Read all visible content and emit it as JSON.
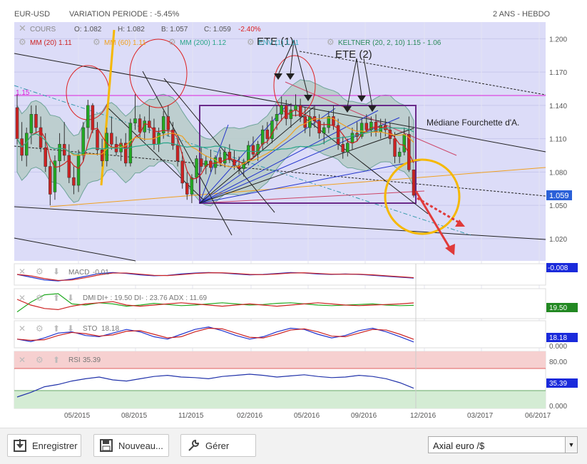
{
  "header": {
    "pair": "EUR-USD",
    "variation": "VARIATION PERIODE : -5.45%",
    "range": "2 ANS - HEBDO"
  },
  "legend": {
    "cours": "COURS",
    "o": "O: 1.082",
    "h": "H: 1.082",
    "b": "B: 1.057",
    "c": "C: 1.059",
    "c_change": "-2.40%",
    "mm20": "MM (20)  1.11",
    "mm60": "MM (60)  1.11",
    "mm200": "MM (200)  1.12",
    "env": "ENV (1)  1.11",
    "keltner": "KELTNER (20, 2, 10)  1.15 - 1.06"
  },
  "annotations": {
    "ete1": "ETE (1)",
    "ete2": "ETE (2)",
    "mediane": "Médiane Fourchette d'A.",
    "level_115": "1.15"
  },
  "colors": {
    "up": "#22aa22",
    "down": "#cc2222",
    "mm20": "#cc2222",
    "mm60": "#f0a020",
    "mm200": "#2aa58a",
    "keltner_fill": "#b7cbc8",
    "panel_bg": "#dcdcf8",
    "rsi_high": "#f6d0d0",
    "rsi_low": "#d4ecd4",
    "orange_mark": "#f5b800",
    "price_badge": "#2a60d8"
  },
  "indicators": {
    "macd": {
      "label": "MACD",
      "value": "-0.01",
      "badge": "-0.008"
    },
    "dmi": {
      "label": "DMI",
      "text": "DI+ : 19.50 DI- : 23.76 ADX : 11.69",
      "badge": "19.50"
    },
    "sto": {
      "label": "STO",
      "value": "18.18",
      "badge": "18.18",
      "axis": "0.000"
    },
    "rsi": {
      "label": "RSI",
      "value": "35.39",
      "badge": "35.39",
      "axis_high": "80.00",
      "axis_low": "0.000"
    }
  },
  "chart_data": {
    "type": "candlestick",
    "price_axis": [
      "1.200",
      "1.170",
      "1.140",
      "1.110",
      "1.080",
      "1.050",
      "1.020"
    ],
    "ylim": [
      1.0,
      1.215
    ],
    "last_price": "1.059",
    "x_ticks": [
      "05/2015",
      "08/2015",
      "11/2015",
      "02/2016",
      "05/2016",
      "09/2016",
      "12/2016",
      "03/2017",
      "06/2017"
    ],
    "candles": [
      [
        1.138,
        1.15,
        1.105,
        1.11
      ],
      [
        1.11,
        1.125,
        1.09,
        1.095
      ],
      [
        1.095,
        1.12,
        1.085,
        1.115
      ],
      [
        1.115,
        1.14,
        1.105,
        1.132
      ],
      [
        1.132,
        1.14,
        1.115,
        1.12
      ],
      [
        1.12,
        1.13,
        1.098,
        1.102
      ],
      [
        1.102,
        1.115,
        1.08,
        1.085
      ],
      [
        1.085,
        1.09,
        1.05,
        1.06
      ],
      [
        1.062,
        1.095,
        1.055,
        1.09
      ],
      [
        1.09,
        1.115,
        1.08,
        1.105
      ],
      [
        1.105,
        1.125,
        1.09,
        1.095
      ],
      [
        1.095,
        1.105,
        1.07,
        1.075
      ],
      [
        1.075,
        1.085,
        1.06,
        1.068
      ],
      [
        1.068,
        1.1,
        1.062,
        1.095
      ],
      [
        1.095,
        1.125,
        1.09,
        1.12
      ],
      [
        1.12,
        1.145,
        1.11,
        1.14
      ],
      [
        1.14,
        1.142,
        1.115,
        1.118
      ],
      [
        1.118,
        1.125,
        1.095,
        1.1
      ],
      [
        1.1,
        1.11,
        1.085,
        1.09
      ],
      [
        1.09,
        1.12,
        1.085,
        1.115
      ],
      [
        1.115,
        1.13,
        1.1,
        1.105
      ],
      [
        1.105,
        1.112,
        1.095,
        1.098
      ],
      [
        1.098,
        1.11,
        1.09,
        1.106
      ],
      [
        1.106,
        1.115,
        1.085,
        1.088
      ],
      [
        1.088,
        1.128,
        1.085,
        1.124
      ],
      [
        1.124,
        1.15,
        1.118,
        1.128
      ],
      [
        1.128,
        1.132,
        1.11,
        1.116
      ],
      [
        1.116,
        1.13,
        1.108,
        1.126
      ],
      [
        1.126,
        1.14,
        1.115,
        1.12
      ],
      [
        1.12,
        1.128,
        1.1,
        1.105
      ],
      [
        1.105,
        1.12,
        1.098,
        1.115
      ],
      [
        1.115,
        1.135,
        1.11,
        1.13
      ],
      [
        1.13,
        1.14,
        1.112,
        1.118
      ],
      [
        1.118,
        1.125,
        1.1,
        1.104
      ],
      [
        1.104,
        1.11,
        1.085,
        1.09
      ],
      [
        1.09,
        1.098,
        1.065,
        1.07
      ],
      [
        1.07,
        1.08,
        1.055,
        1.06
      ],
      [
        1.06,
        1.078,
        1.052,
        1.075
      ],
      [
        1.075,
        1.095,
        1.07,
        1.092
      ],
      [
        1.092,
        1.102,
        1.08,
        1.085
      ],
      [
        1.085,
        1.095,
        1.078,
        1.09
      ],
      [
        1.09,
        1.1,
        1.08,
        1.084
      ],
      [
        1.084,
        1.095,
        1.078,
        1.093
      ],
      [
        1.093,
        1.1,
        1.085,
        1.088
      ],
      [
        1.088,
        1.102,
        1.084,
        1.098
      ],
      [
        1.098,
        1.105,
        1.088,
        1.091
      ],
      [
        1.091,
        1.1,
        1.082,
        1.086
      ],
      [
        1.086,
        1.094,
        1.078,
        1.083
      ],
      [
        1.083,
        1.092,
        1.076,
        1.089
      ],
      [
        1.089,
        1.108,
        1.086,
        1.104
      ],
      [
        1.104,
        1.112,
        1.092,
        1.096
      ],
      [
        1.096,
        1.108,
        1.09,
        1.105
      ],
      [
        1.105,
        1.122,
        1.1,
        1.118
      ],
      [
        1.118,
        1.125,
        1.105,
        1.11
      ],
      [
        1.11,
        1.13,
        1.106,
        1.126
      ],
      [
        1.126,
        1.14,
        1.118,
        1.132
      ],
      [
        1.132,
        1.148,
        1.126,
        1.14
      ],
      [
        1.14,
        1.145,
        1.122,
        1.128
      ],
      [
        1.128,
        1.142,
        1.12,
        1.136
      ],
      [
        1.136,
        1.15,
        1.13,
        1.14
      ],
      [
        1.14,
        1.146,
        1.125,
        1.13
      ],
      [
        1.13,
        1.138,
        1.115,
        1.12
      ],
      [
        1.12,
        1.135,
        1.112,
        1.13
      ],
      [
        1.13,
        1.14,
        1.12,
        1.126
      ],
      [
        1.126,
        1.132,
        1.11,
        1.115
      ],
      [
        1.115,
        1.125,
        1.105,
        1.12
      ],
      [
        1.12,
        1.135,
        1.115,
        1.13
      ],
      [
        1.13,
        1.14,
        1.118,
        1.122
      ],
      [
        1.122,
        1.128,
        1.1,
        1.105
      ],
      [
        1.105,
        1.112,
        1.092,
        1.098
      ],
      [
        1.098,
        1.11,
        1.094,
        1.106
      ],
      [
        1.106,
        1.12,
        1.1,
        1.115
      ],
      [
        1.115,
        1.125,
        1.108,
        1.112
      ],
      [
        1.112,
        1.128,
        1.11,
        1.124
      ],
      [
        1.124,
        1.132,
        1.115,
        1.118
      ],
      [
        1.118,
        1.13,
        1.112,
        1.125
      ],
      [
        1.125,
        1.132,
        1.112,
        1.116
      ],
      [
        1.116,
        1.128,
        1.11,
        1.122
      ],
      [
        1.122,
        1.128,
        1.112,
        1.118
      ],
      [
        1.118,
        1.124,
        1.105,
        1.11
      ],
      [
        1.11,
        1.116,
        1.088,
        1.094
      ],
      [
        1.094,
        1.102,
        1.088,
        1.098
      ],
      [
        1.098,
        1.12,
        1.095,
        1.114
      ],
      [
        1.114,
        1.13,
        1.08,
        1.082
      ],
      [
        1.082,
        1.082,
        1.057,
        1.059
      ]
    ],
    "macd": [
      0.0,
      -0.006,
      -0.012,
      -0.014,
      -0.01,
      -0.004,
      0.002,
      0.004,
      0.002,
      -0.001,
      -0.003,
      -0.002,
      0.001,
      0.003,
      0.004,
      0.003,
      0.001,
      -0.001,
      0.0,
      0.002,
      0.004,
      0.003,
      0.001,
      0.0,
      0.001,
      0.0,
      -0.002,
      -0.004,
      -0.006,
      -0.008
    ],
    "dmi_plus": [
      8,
      25,
      38,
      40,
      22,
      20,
      24,
      22,
      18,
      20,
      23,
      21,
      19,
      20,
      22,
      24,
      22,
      20,
      21,
      23,
      24,
      22,
      20,
      19,
      20,
      21,
      22,
      20,
      19,
      19.5
    ],
    "dmi_minus": [
      30,
      20,
      14,
      12,
      18,
      22,
      24,
      26,
      20,
      18,
      20,
      22,
      24,
      22,
      20,
      18,
      20,
      22,
      20,
      18,
      20,
      22,
      24,
      22,
      20,
      19,
      20,
      21,
      22,
      23.76
    ],
    "sto": [
      30,
      20,
      35,
      55,
      60,
      45,
      40,
      55,
      70,
      60,
      40,
      30,
      50,
      70,
      80,
      65,
      45,
      30,
      40,
      60,
      75,
      70,
      50,
      35,
      45,
      65,
      75,
      60,
      40,
      18.18
    ],
    "rsi": [
      20,
      28,
      38,
      42,
      48,
      52,
      55,
      50,
      48,
      52,
      56,
      58,
      55,
      54,
      52,
      56,
      58,
      60,
      58,
      55,
      57,
      59,
      56,
      54,
      55,
      58,
      56,
      52,
      45,
      35.39
    ]
  },
  "toolbar": {
    "save": "Enregistrer",
    "new": "Nouveau...",
    "manage": "Gérer",
    "selected": "Axial euro /$"
  }
}
